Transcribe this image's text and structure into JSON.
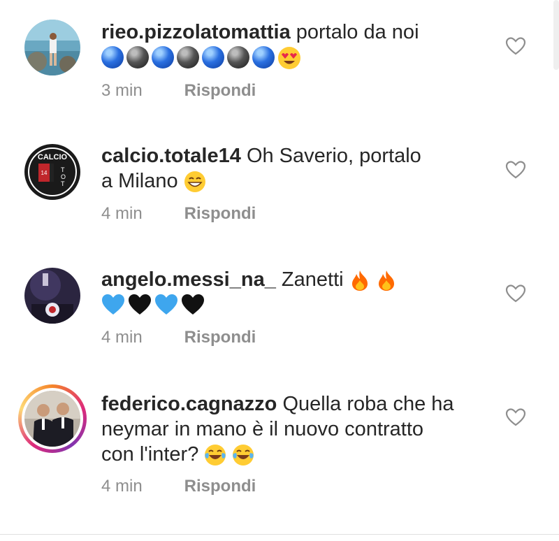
{
  "comments": [
    {
      "username": "rieo.pizzolatomattia",
      "text": "portalo da noi",
      "emoji_line": [
        "blue-ball",
        "black-ball",
        "blue-ball",
        "black-ball",
        "blue-ball",
        "black-ball",
        "blue-ball",
        "heart-eyes"
      ],
      "time": "3 min",
      "reply": "Rispondi"
    },
    {
      "username": "calcio.totale14",
      "text_line1": "Oh Saverio, portalo",
      "text_line2": "a Milano",
      "avatar_text": "CALCIO",
      "avatar_vertical": "TOTALE",
      "time": "4 min",
      "reply": "Rispondi"
    },
    {
      "username": "angelo.messi_na_",
      "text": "Zanetti",
      "emoji_line": [
        "blue-heart",
        "black-heart",
        "blue-heart",
        "black-heart"
      ],
      "time": "4 min",
      "reply": "Rispondi"
    },
    {
      "username": "federico.cagnazzo",
      "text_line1": "Quella roba che ha",
      "text_line2": "neymar in mano è il nuovo contratto",
      "text_line3": "con l'inter?",
      "time": "4 min",
      "reply": "Rispondi"
    }
  ],
  "colors": {
    "text": "#262626",
    "meta": "#8e8e8e",
    "blue": "#2a6fe0",
    "fire": "#ff6a00"
  }
}
